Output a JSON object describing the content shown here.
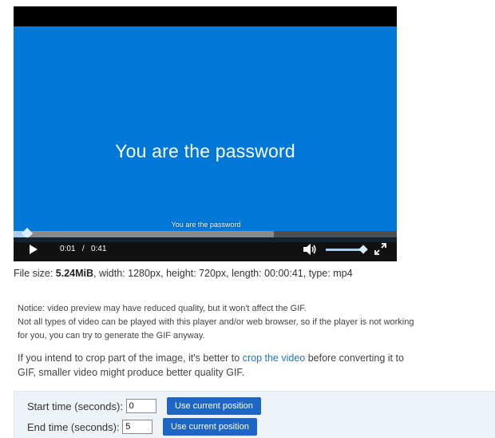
{
  "video": {
    "title_text": "You are the password",
    "subtitle_text": "You are the password",
    "frame_color": "#0078d7",
    "current_time": "0:01",
    "separator": "/",
    "duration": "0:41",
    "progress_played": 0.036,
    "progress_buffered": 0.68,
    "volume_level": 0.9,
    "icons": [
      "play-icon",
      "volume-icon",
      "fullscreen-icon"
    ]
  },
  "file_info": {
    "size_label": "File size: ",
    "size_value": "5.24MiB",
    "rest": ", width: 1280px, height: 720px, length: 00:00:41, type: mp4"
  },
  "notice": {
    "line1": "Notice: video preview may have reduced quality, but it won't affect the GIF.",
    "line2": "Not all types of video can be played with this player and/or web browser, so if the player is not working for you, you can try to generate the GIF anyway."
  },
  "crop_note": {
    "before": "If you intend to crop part of the image, it's better to ",
    "link": "crop the video",
    "after": " before converting it to GIF, smaller video might produce better quality GIF."
  },
  "time_panel": {
    "start_label": "Start time (seconds):",
    "start_value": "0",
    "end_label": "End time (seconds):",
    "end_value": "5",
    "use_position_label": "Use current position",
    "button_color": "#1e66c5"
  }
}
